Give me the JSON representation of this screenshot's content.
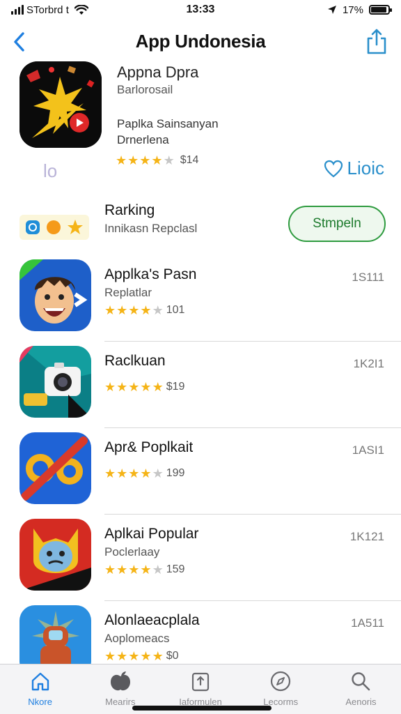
{
  "status_bar": {
    "carrier": "STorbrd t",
    "time": "13:33",
    "battery_percent": "17%",
    "battery_level": 0.9
  },
  "nav": {
    "title": "App Undonesia",
    "back_icon": "chevron-left-icon",
    "share_icon": "share-icon"
  },
  "featured": {
    "title": "Appna Dpra",
    "subtitle": "Barlorosail",
    "desc_line1": "Paplka Sainsanyan",
    "desc_line2": "Drnerlena",
    "rating": 4,
    "rating_text": "$14",
    "page_indicator": "lo",
    "like_label": "Lioic",
    "like_icon": "heart-icon"
  },
  "ranking": {
    "title": "Rarking",
    "subtitle": "Innikasn Repclasl",
    "button_label": "Stmpeln"
  },
  "apps": [
    {
      "name": "Applka's Pasn",
      "subtitle": "Replatlar",
      "rating": 4,
      "rating_text": "101",
      "count": "1S111"
    },
    {
      "name": "Raclkuan",
      "subtitle": "",
      "rating": 4.5,
      "rating_text": "$19",
      "count": "1K2I1"
    },
    {
      "name": "Apr& Poplkait",
      "subtitle": "",
      "rating": 4,
      "rating_text": "199",
      "count": "1ASI1"
    },
    {
      "name": "Aplkai Popular",
      "subtitle": "Poclerlaay",
      "rating": 4,
      "rating_text": "159",
      "count": "1K121"
    },
    {
      "name": "Alonlaeacplala",
      "subtitle": "Aoplomeacs",
      "rating": 4.5,
      "rating_text": "$0",
      "count": "1A511"
    }
  ],
  "tabs": [
    {
      "label": "Nkore",
      "icon": "home-icon",
      "active": true
    },
    {
      "label": "Mearirs",
      "icon": "apple-icon",
      "active": false
    },
    {
      "label": "Iaformulen",
      "icon": "document-icon",
      "active": false
    },
    {
      "label": "Lecorms",
      "icon": "compass-icon",
      "active": false
    },
    {
      "label": "Aenoris",
      "icon": "search-icon",
      "active": false
    }
  ],
  "colors": {
    "accent": "#1f7fe0",
    "star": "#f5b417",
    "button_green": "#2e9b3f",
    "like_blue": "#2a8fcb"
  }
}
